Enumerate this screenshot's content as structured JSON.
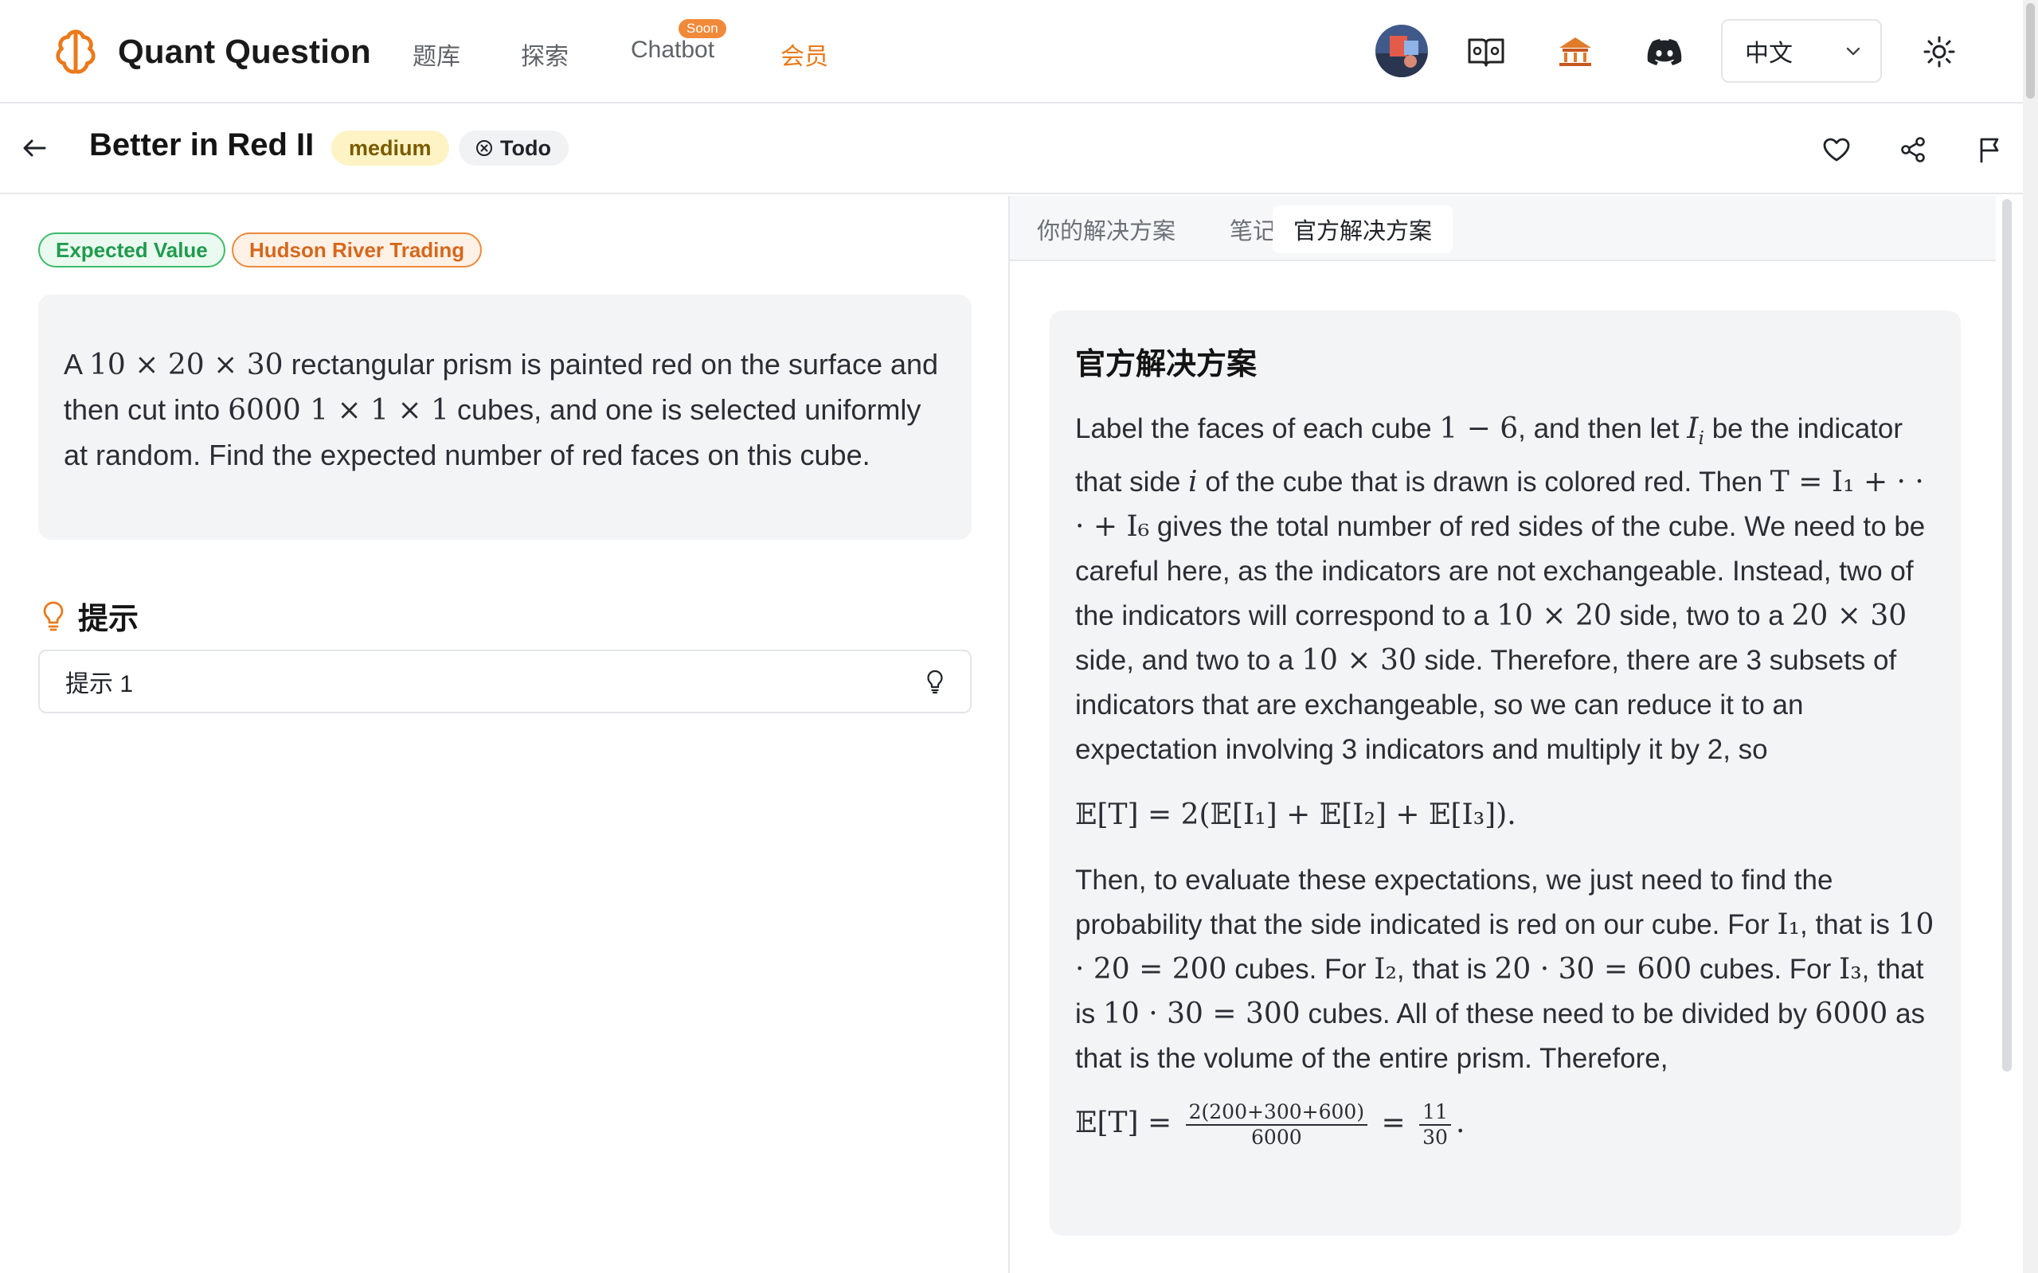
{
  "topnav": {
    "brand": "Quant Question",
    "links": [
      {
        "label": "题库"
      },
      {
        "label": "探索"
      },
      {
        "label": "Chatbot",
        "badge": "Soon"
      },
      {
        "label": "会员"
      }
    ],
    "language": "中文",
    "icons": [
      "brain-logo-icon",
      "avatar",
      "book-icon",
      "temple-icon",
      "discord-icon",
      "chevron-down-icon",
      "sun-icon"
    ],
    "accent": "#ea7a1c"
  },
  "question": {
    "title": "Better in Red II",
    "difficulty": "medium",
    "status": "Todo",
    "tags": [
      "Expected Value",
      "Hudson River Trading"
    ],
    "body": {
      "t1": "A ",
      "m1": "10 × 20 × 30",
      "t2": " rectangular prism is painted red on the surface and then cut into ",
      "m2": "6000 1 × 1 × 1",
      "t3": " cubes, and one is selected uniformly at random. Find the expected number of red faces on this cube."
    }
  },
  "hints": {
    "title": "提示",
    "items": [
      "提示 1"
    ]
  },
  "solution": {
    "tabs": [
      "你的解决方案",
      "笔记",
      "官方解决方案"
    ],
    "active_tab": 2,
    "title": "官方解决方案",
    "p1": {
      "a": "Label the faces of each cube ",
      "m_a": "1 − 6",
      "b": ", and then let ",
      "m_b": "I",
      "m_b_sub": "i",
      "c": " be the indicator that side ",
      "m_c": "i",
      "d": " of the cube that is drawn is colored red. Then ",
      "m_d": "T = I₁ + · · · + I₆",
      "e": " gives the total number of red sides of the cube. We need to be careful here, as the indicators are not exchangeable. Instead, two of the indicators will correspond to a ",
      "m_e": "10 × 20",
      "f": " side, two to a ",
      "m_f": "20 × 30",
      "g": " side, and two to a ",
      "m_g": "10 × 30",
      "h": " side. Therefore, there are 3 subsets of indicators that are exchangeable, so we can reduce it to an expectation involving 3 indicators and multiply it by 2, so"
    },
    "eq1": "𝔼[T] = 2(𝔼[I₁] + 𝔼[I₂] + 𝔼[I₃]).",
    "p2": {
      "a": "Then, to evaluate these expectations, we just need to find the probability that the side indicated is red on our cube. For ",
      "m_a": "I₁",
      "b": ", that is ",
      "m_b": "10 · 20 = 200",
      "c": " cubes. For ",
      "m_c": "I₂",
      "d": ", that is ",
      "m_d": "20 · 30 = 600",
      "e": " cubes. For ",
      "m_e": "I₃",
      "f": ", that is ",
      "m_f": "10 · 30 = 300",
      "g": " cubes. All of these need to be divided by ",
      "m_g": "6000",
      "h": " as that is the volume of the entire prism. Therefore,"
    },
    "eq2": {
      "lhs": "𝔼[T] =",
      "num1": "2(200+300+600)",
      "den1": "6000",
      "eq": "=",
      "num2": "11",
      "den2": "30",
      "end": "."
    }
  }
}
